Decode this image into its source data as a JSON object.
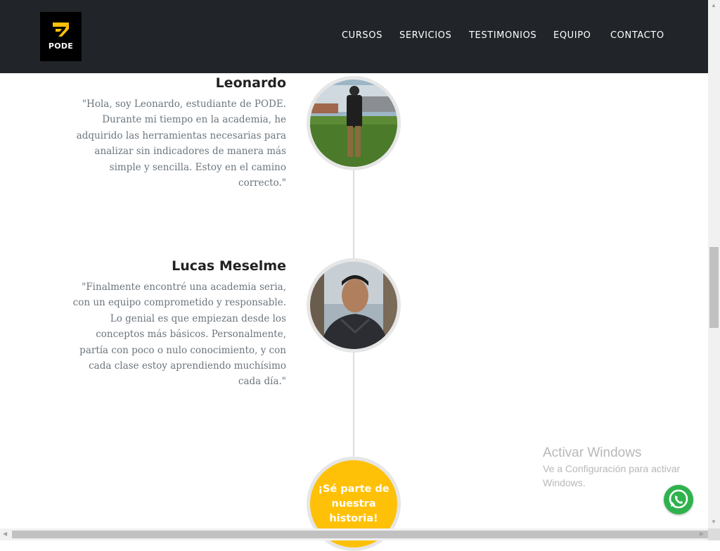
{
  "brand": {
    "logo_text": "PODE"
  },
  "nav": [
    "CURSOS",
    "SERVICIOS",
    "TESTIMONIOS",
    "EQUIPO",
    "CONTACTO"
  ],
  "testimonials": [
    {
      "name": "Leonardo",
      "quote_lines": [
        "\"Hola, soy Leonardo, estudiante de PODE.",
        "Durante mi tiempo en la academia, he",
        "adquirido las herramientas necesarias para",
        "analizar sin indicadores de manera más",
        "simple y sencilla. Estoy en el camino",
        "correcto.\""
      ]
    },
    {
      "name": "Lucas Meselme",
      "quote_lines": [
        "\"Finalmente encontré una academia seria,",
        "con un equipo comprometido y responsable.",
        "Lo genial es que empiezan desde los",
        "conceptos más básicos. Personalmente,",
        "partía con poco o nulo conocimiento, y con",
        "cada clase estoy aprendiendo muchísimo",
        "cada día.\""
      ]
    }
  ],
  "cta": {
    "label": "¡Sé parte de nuestra historia!"
  },
  "overlay": {
    "activate_title": "Activar Windows",
    "activate_text": "Ve a Configuración para activar Windows."
  },
  "icons": {
    "chat": "whatsapp-icon"
  },
  "colors": {
    "navbar": "#212529",
    "accent": "#ffc107",
    "logo_bg": "#000000",
    "whatsapp": "#2fb24d"
  }
}
